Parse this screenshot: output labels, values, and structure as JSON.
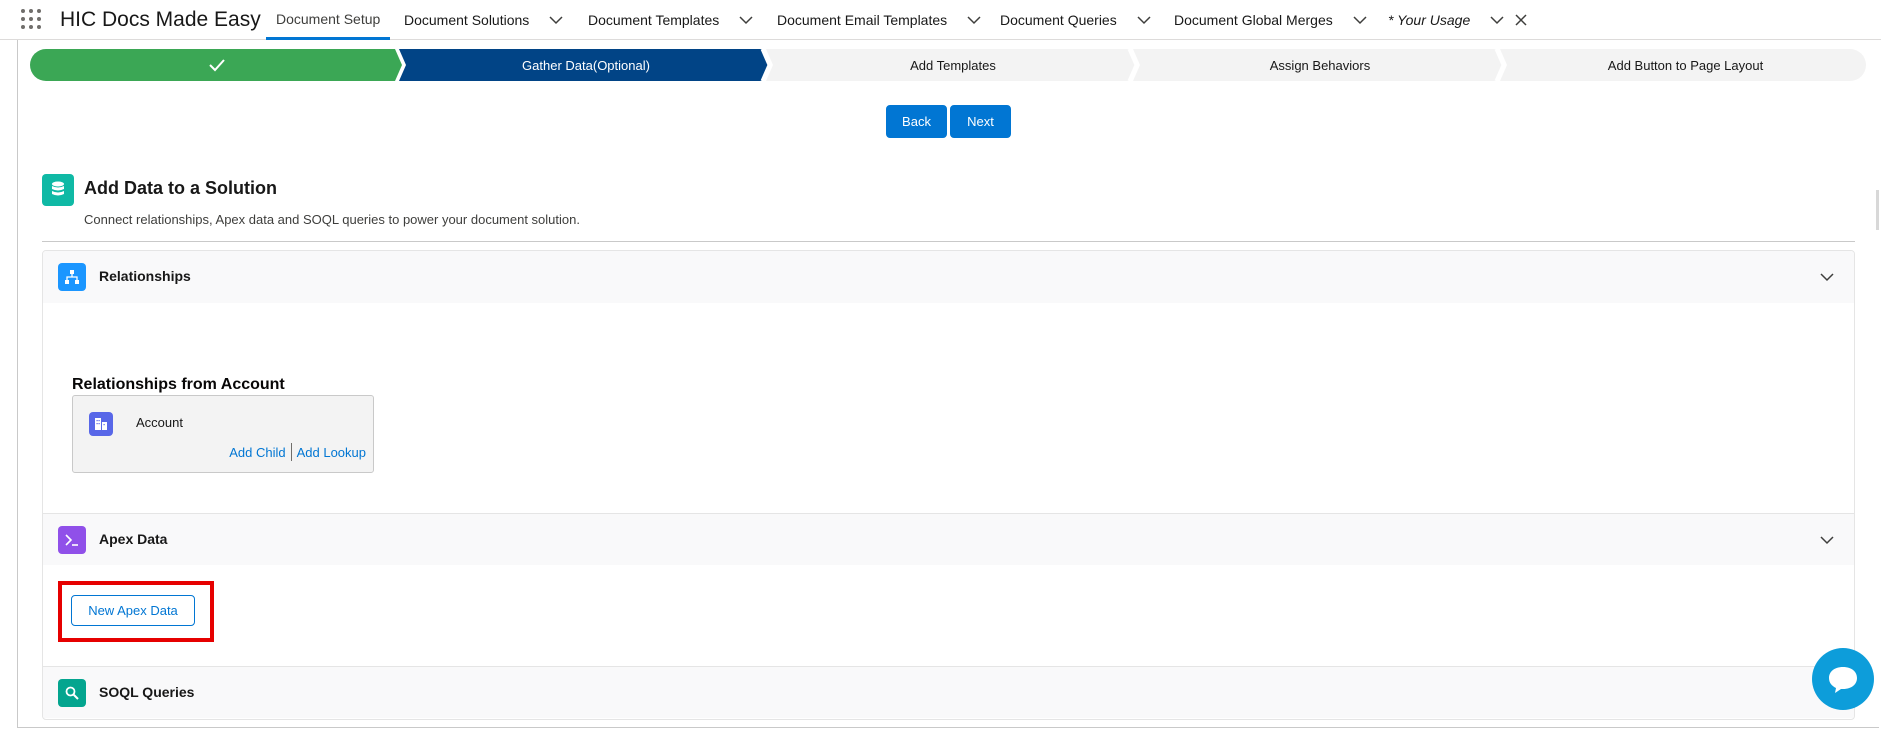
{
  "app": {
    "name": "HIC Docs Made Easy"
  },
  "nav": {
    "tabs": [
      {
        "label": "Document Setup"
      },
      {
        "label": "Document Solutions"
      },
      {
        "label": "Document Templates"
      },
      {
        "label": "Document Email Templates"
      },
      {
        "label": "Document Queries"
      },
      {
        "label": "Document Global Merges"
      },
      {
        "label": "* Your Usage"
      }
    ]
  },
  "path": {
    "stages": [
      {
        "label": "",
        "status": "complete"
      },
      {
        "label": "Gather Data(Optional)",
        "status": "current"
      },
      {
        "label": "Add Templates",
        "status": "incomplete"
      },
      {
        "label": "Assign Behaviors",
        "status": "incomplete"
      },
      {
        "label": "Add Button to Page Layout",
        "status": "incomplete"
      }
    ]
  },
  "actions": {
    "back_label": "Back",
    "next_label": "Next"
  },
  "section": {
    "title": "Add Data to a Solution",
    "subtitle": "Connect relationships, Apex data and SOQL queries to power your document solution."
  },
  "accordion": {
    "relationships": {
      "label": "Relationships",
      "heading": "Relationships from Account",
      "card": {
        "name": "Account",
        "add_child": "Add Child",
        "add_lookup": "Add Lookup"
      }
    },
    "apex": {
      "label": "Apex Data",
      "button_label": "New Apex Data"
    },
    "soql": {
      "label": "SOQL Queries"
    }
  },
  "colors": {
    "brand": "#0176d3",
    "path_complete": "#3ba755",
    "path_current": "#014486",
    "path_incomplete": "#f3f3f3",
    "highlight": "#e60000",
    "relationships_icon": "#1b96ff",
    "apex_icon": "#9050e9",
    "soql_icon": "#04a58f"
  },
  "icons": {
    "app_launcher": "waffle-icon",
    "tab_menu": "chevron-down-icon",
    "close_tab": "close-icon",
    "section": "database-icon",
    "relationships": "hierarchy-icon",
    "account": "account-icon",
    "apex": "terminal-icon",
    "soql": "search-icon",
    "chat": "chat-icon",
    "complete_stage": "check-icon"
  }
}
